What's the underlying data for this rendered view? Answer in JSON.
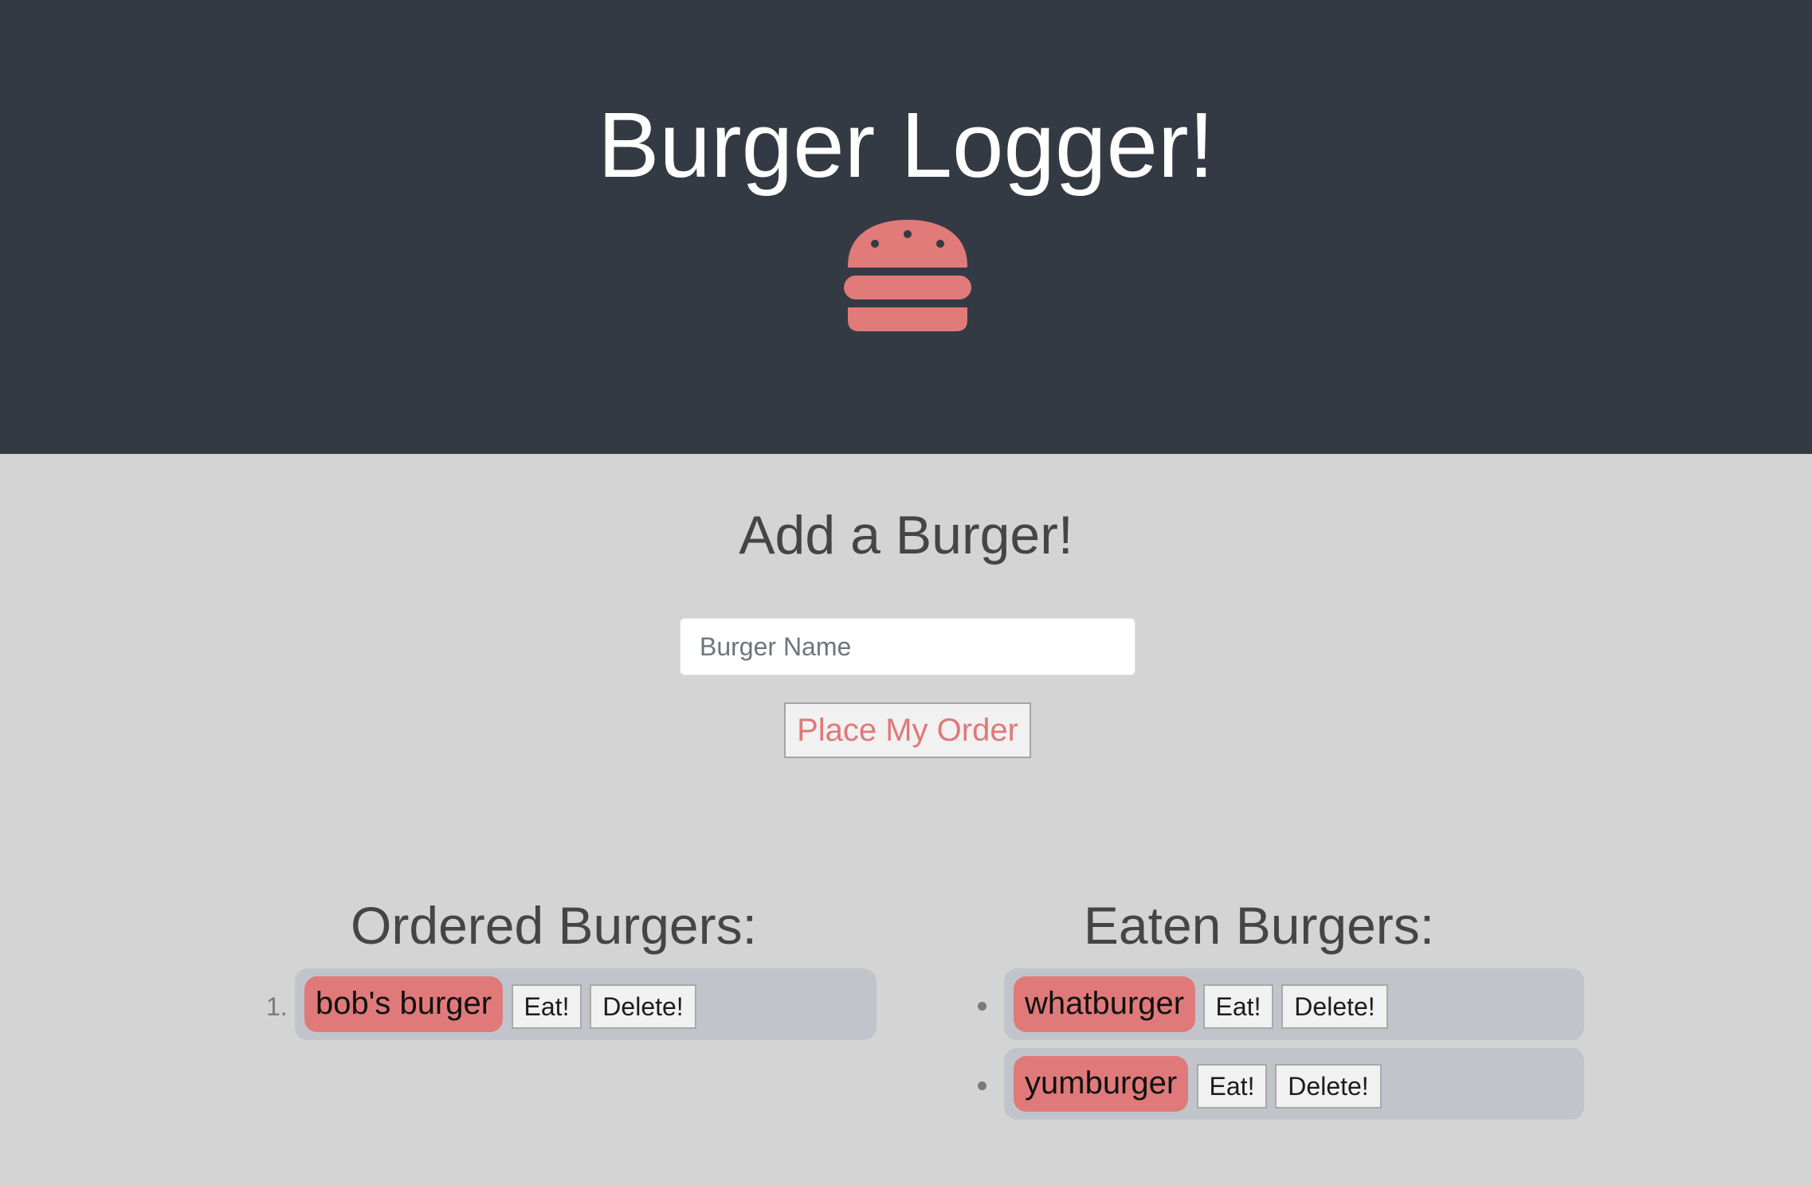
{
  "header": {
    "title": "Burger Logger!",
    "icon": "burger-icon",
    "background_color": "#343a43",
    "icon_color": "#e07878"
  },
  "add_form": {
    "heading": "Add a Burger!",
    "input_placeholder": "Burger Name",
    "input_value": "",
    "submit_label": "Place My Order"
  },
  "ordered": {
    "heading": "Ordered Burgers:",
    "items": [
      {
        "marker": "1.",
        "name": "bob's burger",
        "eat_label": "Eat!",
        "delete_label": "Delete!"
      }
    ]
  },
  "eaten": {
    "heading": "Eaten Burgers:",
    "items": [
      {
        "name": "whatburger",
        "eat_label": "Eat!",
        "delete_label": "Delete!"
      },
      {
        "name": "yumburger",
        "eat_label": "Eat!",
        "delete_label": "Delete!"
      }
    ]
  },
  "colors": {
    "page_background": "#d4d4d4",
    "burger_tag": "#e07a7a",
    "row_background": "#c1c5cb",
    "order_button_text": "#e07878"
  }
}
